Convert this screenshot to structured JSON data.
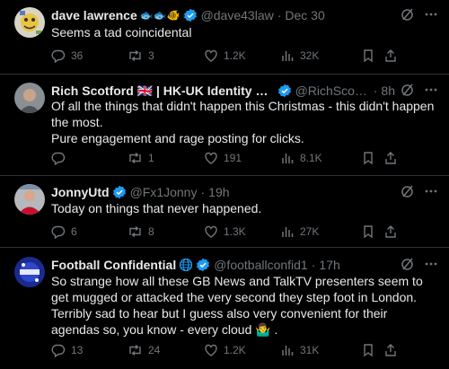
{
  "tweets": [
    {
      "name": "dave lawrence",
      "name_extra": "🐟🐟🐠",
      "handle": "@dave43law",
      "separator": "·",
      "time": "Dec 30",
      "text": "Seems a tad coincidental",
      "replies": "36",
      "reposts": "3",
      "likes": "1.2K",
      "views": "32K"
    },
    {
      "name": "Rich Scotford 🇬🇧 | HK-UK Identity & Bitc...",
      "handle": "@RichScotfo...",
      "separator": "·",
      "time": "8h",
      "text": "Of all the things that didn't happen this Christmas - this didn't happen the most.\nPure engagement and rage posting for clicks.",
      "replies": "",
      "reposts": "1",
      "likes": "191",
      "views": "8.1K"
    },
    {
      "name": "JonnyUtd",
      "handle": "@Fx1Jonny",
      "separator": "·",
      "time": "19h",
      "text": "Today on things that never happened.",
      "replies": "6",
      "reposts": "8",
      "likes": "1.3K",
      "views": "27K"
    },
    {
      "name": "Football Confidential",
      "name_extra": "globe",
      "handle": "@footballconfid1",
      "separator": "·",
      "time": "17h",
      "text": "So strange how all these GB News and TalkTV presenters seem to get mugged or attacked the very second they step foot in London. Terribly sad to hear but I guess also very convenient for their agendas so, you know - every cloud 🤷‍♂️ .",
      "replies": "13",
      "reposts": "24",
      "likes": "1.2K",
      "views": "31K"
    }
  ],
  "colors": {
    "background": "#000000",
    "text": "#e7e9ea",
    "muted": "#71767b",
    "divider": "#2f3336",
    "verified": "#1d9bf0"
  },
  "icons": [
    "grok-icon",
    "more-icon",
    "reply-icon",
    "repost-icon",
    "like-icon",
    "views-icon",
    "bookmark-icon",
    "share-icon",
    "verified-badge-icon",
    "globe-icon"
  ]
}
